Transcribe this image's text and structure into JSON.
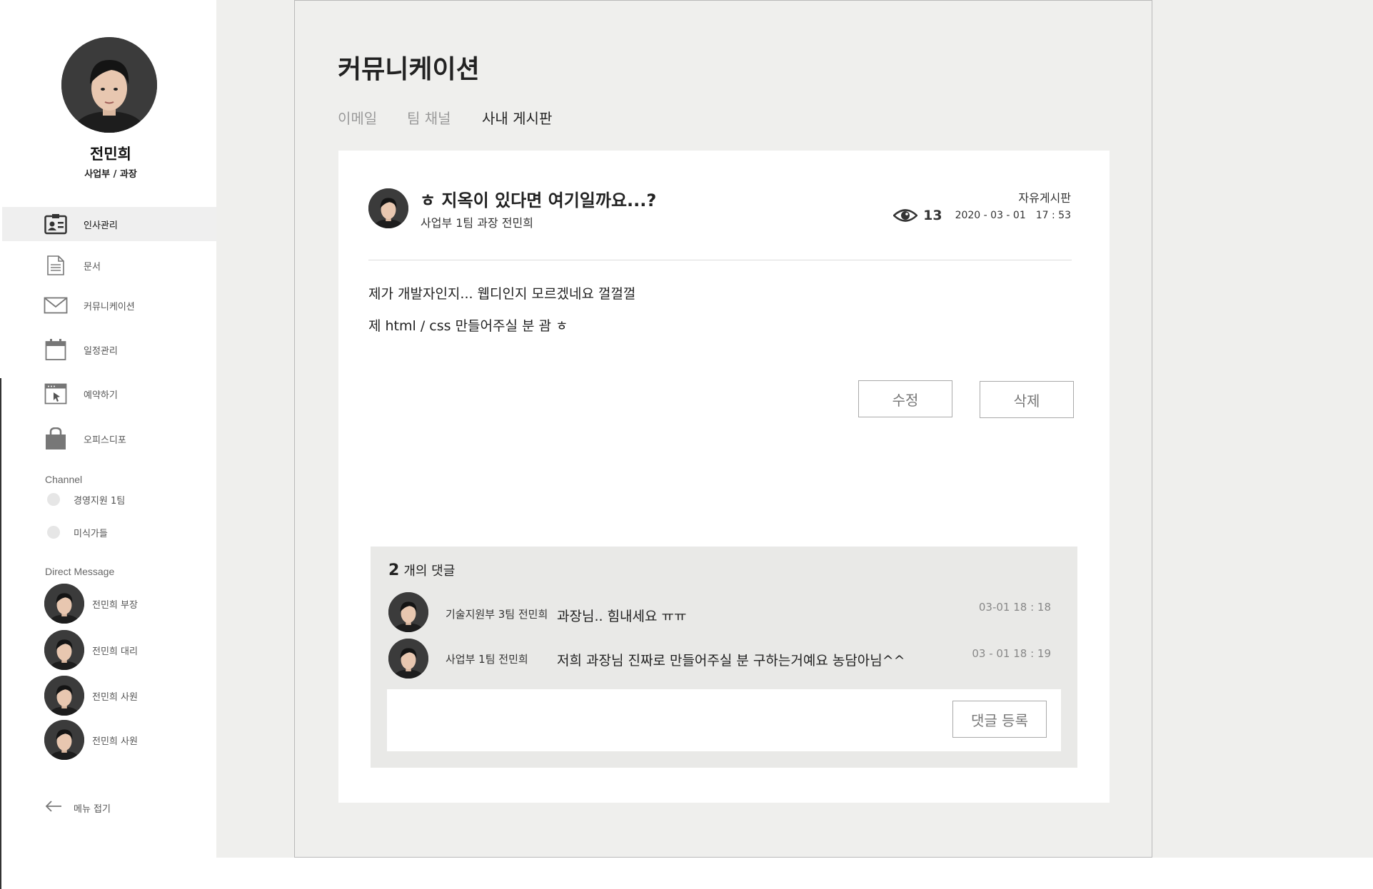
{
  "user": {
    "name": "전민희",
    "role": "사업부  /  과장"
  },
  "nav": {
    "items": [
      {
        "label": "인사관리",
        "icon": "id-card-icon",
        "active": true
      },
      {
        "label": "문서",
        "icon": "document-icon",
        "active": false
      },
      {
        "label": "커뮤니케이션",
        "icon": "mail-icon",
        "active": false
      },
      {
        "label": "일정관리",
        "icon": "calendar-icon",
        "active": false
      },
      {
        "label": "예약하기",
        "icon": "reservation-icon",
        "active": false
      },
      {
        "label": "오피스디포",
        "icon": "shopping-bag-icon",
        "active": false
      }
    ]
  },
  "channels": {
    "heading": "Channel",
    "items": [
      {
        "label": "경영지원  1팀"
      },
      {
        "label": "미식가들"
      }
    ]
  },
  "direct_messages": {
    "heading": "Direct Message",
    "items": [
      {
        "label": "전민희  부장"
      },
      {
        "label": "전민희  대리"
      },
      {
        "label": "전민희  사원"
      },
      {
        "label": "전민희  사원"
      }
    ]
  },
  "collapse_menu": {
    "label": "메뉴  접기",
    "icon": "arrow-left-icon"
  },
  "page": {
    "title": "커뮤니케이션",
    "tabs": [
      {
        "label": "이메일",
        "active": false
      },
      {
        "label": "팀 채널",
        "active": false
      },
      {
        "label": "사내 게시판",
        "active": true
      }
    ]
  },
  "post": {
    "title": "ㅎ 지옥이 있다면 여기일까요...?",
    "author": "사업부 1팀 과장 전민희",
    "board": "자유게시판",
    "views": "13",
    "date": "2020 - 03 - 01",
    "time": "17 : 53",
    "body": [
      "제가 개발자인지... 웹디인지 모르겠네요 껄껄껄",
      "제 html / css 만들어주실 분 괌 ㅎ"
    ],
    "edit_label": "수정",
    "delete_label": "삭제"
  },
  "comments": {
    "count": "2",
    "count_label": "개의 댓글",
    "items": [
      {
        "author": "기술지원부 3팀 전민희",
        "text": "과장님.. 힘내세요 ㅠㅠ",
        "date": "03-01      18 : 18"
      },
      {
        "author": "사업부 1팀 전민희",
        "text": "저희 과장님 진짜로 만들어주실 분 구하는거예요 농담아님^^",
        "date": "03 - 01     18 : 19"
      }
    ],
    "submit_label": "댓글 등록"
  },
  "colors": {
    "sidebar_active": "#efefef",
    "main_background": "#efefed",
    "card": "#ffffff",
    "comments_background": "#e9e9e7"
  }
}
